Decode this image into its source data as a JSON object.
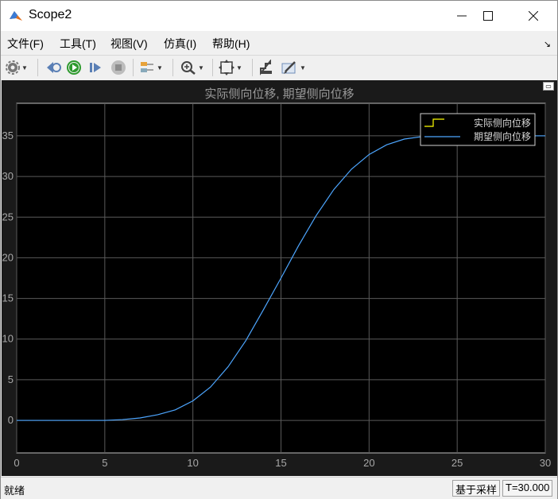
{
  "window": {
    "title": "Scope2"
  },
  "menu": [
    "文件(F)",
    "工具(T)",
    "视图(V)",
    "仿真(I)",
    "帮助(H)"
  ],
  "toolbar": [
    "gear-icon",
    "step-back-icon",
    "run-icon",
    "step-forward-icon",
    "stop-icon",
    "signal-icon",
    "zoom-icon",
    "autoscale-icon",
    "highlight-icon",
    "edit-icon"
  ],
  "plot": {
    "title": "实际侧向位移, 期望侧向位移"
  },
  "chart_data": {
    "type": "line",
    "title": "实际侧向位移, 期望侧向位移",
    "xlabel": "",
    "ylabel": "",
    "xlim": [
      0,
      30
    ],
    "ylim": [
      -4,
      39
    ],
    "xticks": [
      0,
      5,
      10,
      15,
      20,
      25,
      30
    ],
    "yticks": [
      0,
      5,
      10,
      15,
      20,
      25,
      30,
      35
    ],
    "grid": true,
    "legend_position": "top-right",
    "background": "#000000",
    "series": [
      {
        "name": "实际侧向位移",
        "color": "#ffff00",
        "x": [],
        "y": []
      },
      {
        "name": "期望侧向位移",
        "color": "#4da6ff",
        "x": [
          0,
          5,
          6,
          7,
          8,
          9,
          10,
          11,
          12,
          13,
          14,
          15,
          16,
          17,
          18,
          19,
          20,
          21,
          22,
          23,
          24,
          25,
          30
        ],
        "y": [
          0,
          0,
          0.1,
          0.3,
          0.7,
          1.3,
          2.4,
          4.1,
          6.6,
          9.8,
          13.6,
          17.5,
          21.5,
          25.2,
          28.4,
          30.9,
          32.7,
          33.9,
          34.6,
          34.9,
          35,
          35,
          35
        ]
      }
    ]
  },
  "status": {
    "left": "就绪",
    "mode": "基于采样",
    "time": "T=30.000"
  }
}
